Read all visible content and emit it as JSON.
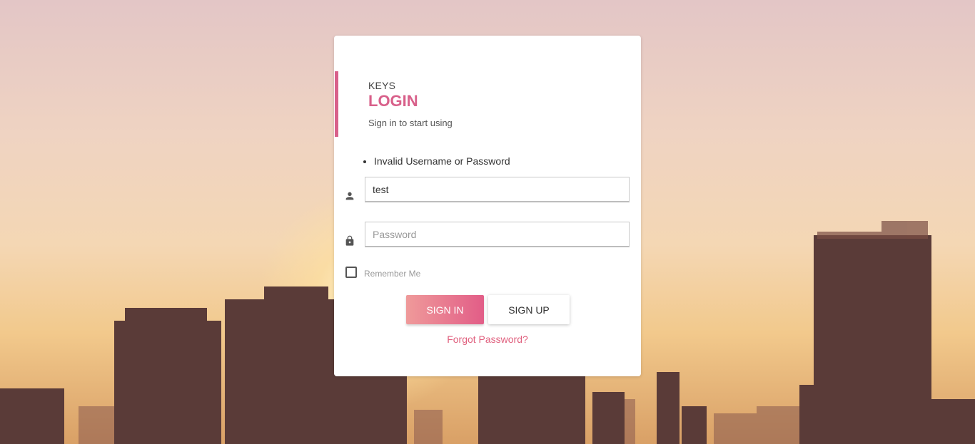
{
  "login": {
    "brand": "KEYS",
    "title": "LOGIN",
    "subtitle": "Sign in to start using",
    "errors": [
      "Invalid Username or Password"
    ],
    "username_value": "test",
    "password_placeholder": "Password",
    "remember_label": "Remember Me",
    "remember_checked": false,
    "signin_label": "SIGN IN",
    "signup_label": "SIGN UP",
    "forgot_label": "Forgot Password?"
  },
  "icons": {
    "user": "user-icon",
    "lock": "lock-icon"
  },
  "colors": {
    "accent": "#d8608a",
    "button_gradient_start": "#ef9a9a",
    "button_gradient_end": "#e25d87",
    "link": "#e0607e"
  }
}
